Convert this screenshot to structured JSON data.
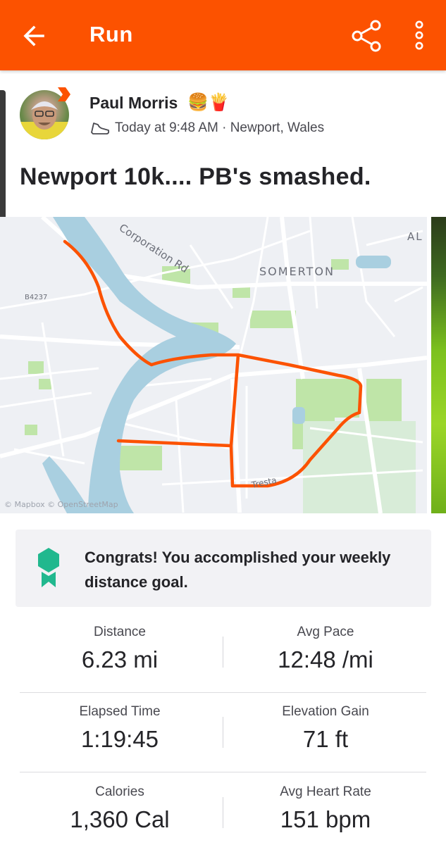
{
  "header": {
    "title": "Run",
    "bg_color": "#fc5200"
  },
  "athlete": {
    "name": "Paul Morris",
    "emoji": "🍔🍟",
    "meta": "Today at 9:48 AM · Newport, Wales"
  },
  "activity": {
    "title": "Newport 10k.... PB's smashed."
  },
  "map": {
    "labels": {
      "road": "Corporation Rd",
      "district": "SOMERTON",
      "route_code": "B4237",
      "corner": "AL",
      "street": "Tresta"
    },
    "attribution": "© Mapbox © OpenStreetMap",
    "route_color": "#fc5200"
  },
  "goal": {
    "text": "Congrats! You accomplished your weekly distance goal.",
    "medal_color": "#21b88e"
  },
  "stats": [
    {
      "label": "Distance",
      "value": "6.23 mi"
    },
    {
      "label": "Avg Pace",
      "value": "12:48 /mi"
    },
    {
      "label": "Elapsed Time",
      "value": "1:19:45"
    },
    {
      "label": "Elevation Gain",
      "value": "71 ft"
    },
    {
      "label": "Calories",
      "value": "1,360 Cal"
    },
    {
      "label": "Avg Heart Rate",
      "value": "151 bpm"
    }
  ]
}
